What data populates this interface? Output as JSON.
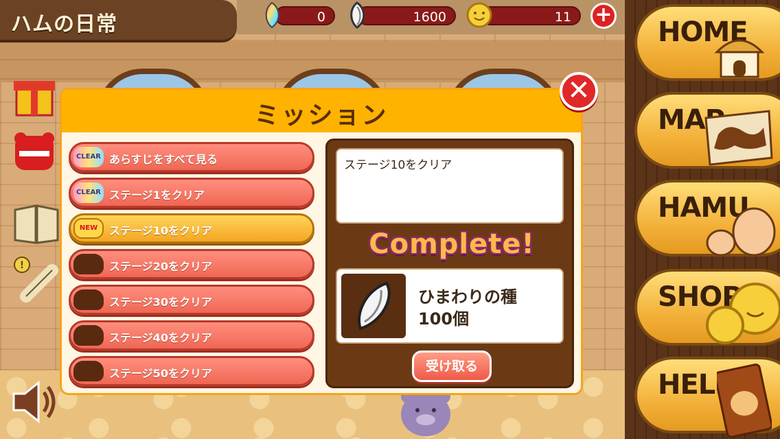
{
  "title": "ハムの日常",
  "hud": {
    "rainbow_seeds": "0",
    "sunflower_seeds": "1600",
    "coins": "11",
    "add_label": "+"
  },
  "nav": {
    "home": "HOME",
    "map": "MAP",
    "hamu": "HAMU",
    "shop": "SHOP",
    "help": "HELP"
  },
  "modal": {
    "title": "ミッション",
    "close_label": "✕",
    "missions": [
      {
        "badge": "CLEAR",
        "label": "あらすじをすべて見る",
        "state": "clear"
      },
      {
        "badge": "CLEAR",
        "label": "ステージ1をクリア",
        "state": "clear"
      },
      {
        "badge": "NEW",
        "label": "ステージ10をクリア",
        "state": "new"
      },
      {
        "badge": "",
        "label": "ステージ20をクリア",
        "state": "locked"
      },
      {
        "badge": "",
        "label": "ステージ30をクリア",
        "state": "locked"
      },
      {
        "badge": "",
        "label": "ステージ40をクリア",
        "state": "locked"
      },
      {
        "badge": "",
        "label": "ステージ50をクリア",
        "state": "locked"
      }
    ],
    "detail": {
      "description": "ステージ10をクリア",
      "status": "Complete!",
      "reward_name": "ひまわりの種",
      "reward_amount": "100個",
      "receive_label": "受け取る"
    }
  },
  "colors": {
    "mission_default": "#f06754",
    "mission_active": "#f5a623",
    "header": "#ffb300",
    "detail_panel": "#6b3a14"
  },
  "icons": [
    "rainbow-seed-icon",
    "sunflower-seed-icon",
    "coin-icon",
    "plus-icon",
    "gift-icon",
    "hamster-badge-icon",
    "book-icon",
    "scroll-icon",
    "speaker-icon",
    "close-icon"
  ]
}
